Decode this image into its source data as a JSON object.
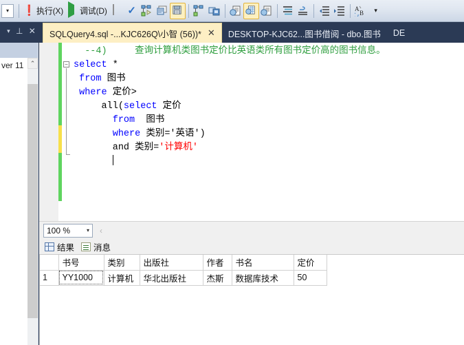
{
  "toolbar": {
    "overflow_label": "▾",
    "buttons": [
      {
        "name": "execute",
        "icon": "exclamation-icon",
        "label": "执行(X)",
        "active": false
      },
      {
        "name": "debug",
        "icon": "play-icon",
        "label": "调试(D)",
        "active": false
      },
      {
        "name": "stop",
        "icon": "stop-icon",
        "label": "",
        "active": false
      },
      {
        "name": "parse",
        "icon": "check-icon",
        "label": "",
        "active": false
      },
      {
        "name": "display-estimated-plan",
        "icon": "estimated-plan-icon",
        "label": "",
        "active": false
      },
      {
        "name": "query-options",
        "icon": "query-options-icon",
        "label": "",
        "active": false
      },
      {
        "name": "results-to-text",
        "icon": "results-to-text-icon",
        "label": "",
        "active": true
      },
      {
        "name": "include-actual-plan",
        "icon": "actual-plan-icon",
        "label": "",
        "active": false
      },
      {
        "name": "include-client-statistics",
        "icon": "client-statistics-icon",
        "label": "",
        "active": false
      },
      {
        "name": "results-to-text2",
        "icon": "results-text-icon",
        "label": "",
        "active": false
      },
      {
        "name": "results-to-grid",
        "icon": "results-grid-icon",
        "label": "",
        "active": true
      },
      {
        "name": "results-to-file",
        "icon": "results-file-icon",
        "label": "",
        "active": false
      },
      {
        "name": "comment-lines",
        "icon": "comment-lines-icon",
        "label": "",
        "active": false
      },
      {
        "name": "uncomment-lines",
        "icon": "uncomment-lines-icon",
        "label": "",
        "active": false
      },
      {
        "name": "decrease-indent",
        "icon": "decrease-indent-icon",
        "label": "",
        "active": false
      },
      {
        "name": "increase-indent",
        "icon": "increase-indent-icon",
        "label": "",
        "active": false
      },
      {
        "name": "font-options",
        "icon": "font-ab-icon",
        "label": "",
        "active": false
      }
    ],
    "chevron_label": "▾"
  },
  "tabstrip": {
    "controls": [
      {
        "name": "tab-list-dropdown",
        "glyph": "▾"
      },
      {
        "name": "pin",
        "glyph": "⊥"
      },
      {
        "name": "close-panel",
        "glyph": "✕"
      }
    ],
    "tabs": [
      {
        "label": "SQLQuery4.sql -...KJC626Q\\小智 (56))*",
        "selected": true,
        "close": "✕"
      },
      {
        "label": "DESKTOP-KJC62...图书借阅 - dbo.图书",
        "selected": false,
        "close": ""
      },
      {
        "label": "DE",
        "selected": false,
        "close": ""
      }
    ]
  },
  "left_dock": {
    "text": "ver 11",
    "scroll_up_glyph": "⌃"
  },
  "editor": {
    "zoom_level": "100 %",
    "zoom_arrow": "▾",
    "zoom_nav": "‹",
    "code_lines": [
      {
        "indent": 2,
        "segments": [
          {
            "t": "--4)     查询计算机类图书定价比英语类所有图书定价高的图书信息。",
            "c": "cmt"
          }
        ]
      },
      {
        "indent": 0,
        "fold": "minus",
        "segments": [
          {
            "t": "select",
            "c": "kw"
          },
          {
            "t": " *",
            "c": "plain"
          }
        ]
      },
      {
        "indent": 1,
        "segments": [
          {
            "t": "from",
            "c": "kw"
          },
          {
            "t": " 图书",
            "c": "plain"
          }
        ]
      },
      {
        "indent": 1,
        "segments": [
          {
            "t": "where",
            "c": "kw"
          },
          {
            "t": " 定价>",
            "c": "plain"
          }
        ]
      },
      {
        "indent": 5,
        "segments": [
          {
            "t": "all(",
            "c": "plain"
          },
          {
            "t": "select",
            "c": "kw"
          },
          {
            "t": " 定价",
            "c": "plain"
          }
        ]
      },
      {
        "indent": 7,
        "segments": [
          {
            "t": "from",
            "c": "kw"
          },
          {
            "t": "  图书",
            "c": "plain"
          }
        ]
      },
      {
        "indent": 7,
        "segments": [
          {
            "t": "where",
            "c": "kw"
          },
          {
            "t": " 类别='英语')",
            "c": "plain"
          }
        ]
      },
      {
        "indent": 7,
        "segments": [
          {
            "t": "and",
            "c": "plain"
          },
          {
            "t": " 类别=",
            "c": "plain"
          },
          {
            "t": "'计算机'",
            "c": "red"
          }
        ]
      },
      {
        "indent": 7,
        "segments": [
          {
            "t": "",
            "c": "plain"
          }
        ],
        "caret": true
      }
    ]
  },
  "results": {
    "tabs": [
      {
        "name": "results",
        "icon": "grid-icon",
        "label": "结果"
      },
      {
        "name": "messages",
        "icon": "message-icon",
        "label": "消息"
      }
    ],
    "columns": [
      "",
      "书号",
      "类别",
      "出版社",
      "作者",
      "书名",
      "定价"
    ],
    "rows": [
      {
        "index": "1",
        "cells": [
          "YY1000",
          "计算机",
          "华北出版社",
          "杰斯",
          "数据库技术",
          "50"
        ]
      }
    ]
  },
  "colors": {
    "tab_selected_bg": "#fdefc4",
    "tabstrip_bg": "#2b3a55",
    "toolbar_active_border": "#e3b33c",
    "keyword": "#0000ff",
    "comment": "#2e9e3e",
    "string_error": "#ff0000",
    "change_bar_saved": "#5fd45f",
    "change_bar_unsaved": "#f7e04b"
  }
}
